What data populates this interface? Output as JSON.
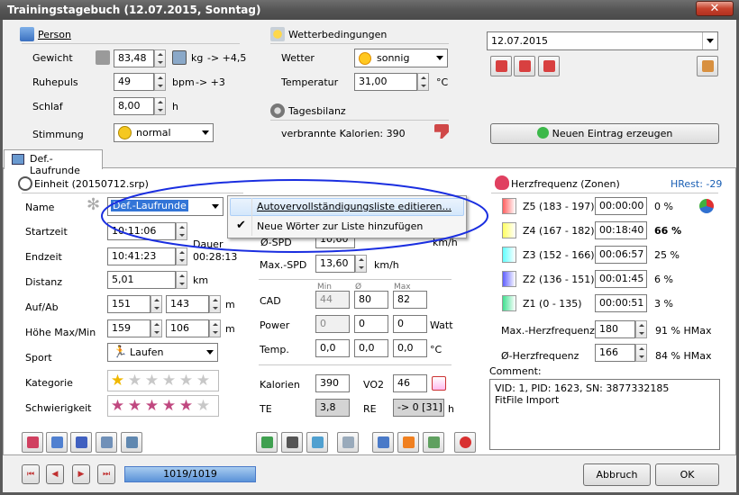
{
  "window": {
    "title": "Trainingstagebuch (12.07.2015, Sonntag)",
    "close": "✕"
  },
  "person": {
    "header": "Person",
    "gewicht": {
      "label": "Gewicht",
      "value": "83,48",
      "unit": "kg",
      "delta": "-> +4,5"
    },
    "ruhepuls": {
      "label": "Ruhepuls",
      "value": "49",
      "unit": "bpm",
      "delta": "-> +3"
    },
    "schlaf": {
      "label": "Schlaf",
      "value": "8,00",
      "unit": "h"
    },
    "stimmung": {
      "label": "Stimmung",
      "value": "normal"
    }
  },
  "weather": {
    "header": "Wetterbedingungen",
    "wetter_label": "Wetter",
    "wetter_value": "sonnig",
    "temp_label": "Temperatur",
    "temp_value": "31,00",
    "temp_unit": "°C"
  },
  "balance": {
    "header": "Tagesbilanz",
    "text": "verbrannte Kalorien: 390"
  },
  "date": {
    "value": "12.07.2015"
  },
  "new_entry_label": "Neuen Eintrag erzeugen",
  "tab": {
    "label": "Def.-Laufrunde"
  },
  "unit": {
    "header": "Einheit (20150712.srp)",
    "name_label": "Name",
    "name_value": "Def.-Laufrunde",
    "start_label": "Startzeit",
    "start_value": "10:11:06",
    "end_label": "Endzeit",
    "end_value": "10:41:23",
    "dauer_label": "Dauer",
    "dauer_value": "00:28:13",
    "dist_label": "Distanz",
    "dist_value": "5,01",
    "dist_unit": "km",
    "aufab_label": "Auf/Ab",
    "auf_value": "151",
    "ab_value": "143",
    "aufab_unit": "m",
    "hoehe_label": "Höhe Max/Min",
    "hmax_value": "159",
    "hmin_value": "106",
    "hoehe_unit": "m",
    "sport_label": "Sport",
    "sport_value": "Laufen",
    "kategorie_label": "Kategorie",
    "kategorie_rating": 1,
    "schwierig_label": "Schwierigkeit",
    "schwierig_rating": 5,
    "stars_max": 6
  },
  "speed": {
    "avg_label": "Ø-SPD",
    "avg_value": "10,60",
    "avg_unit": "km/h",
    "max_label": "Max.-SPD",
    "max_value": "13,60",
    "max_unit": "km/h"
  },
  "sensors": {
    "col_min": "Min",
    "col_avg": "Ø",
    "col_max": "Max",
    "cad_label": "CAD",
    "cad": [
      "44",
      "80",
      "82"
    ],
    "power_label": "Power",
    "power": [
      "0",
      "0",
      "0"
    ],
    "power_unit": "Watt",
    "temp_label": "Temp.",
    "temp": [
      "0,0",
      "0,0",
      "0,0"
    ],
    "temp_unit": "°C",
    "kal_label": "Kalorien",
    "kal_value": "390",
    "vo2_label": "VO2",
    "vo2_value": "46",
    "te_label": "TE",
    "te_value": "3,8",
    "re_label": "RE",
    "re_value": "-> 0 [31]",
    "re_unit": "h"
  },
  "hr": {
    "header": "Herzfrequenz (Zonen)",
    "hrest": "HRest: -29",
    "zones": [
      {
        "label": "Z5 (183 - 197)",
        "time": "00:00:00",
        "pct": "0 %",
        "color": "#ff6060"
      },
      {
        "label": "Z4 (167 - 182)",
        "time": "00:18:40",
        "pct": "66 %",
        "color": "#ffff60"
      },
      {
        "label": "Z3 (152 - 166)",
        "time": "00:06:57",
        "pct": "25 %",
        "color": "#60ffff"
      },
      {
        "label": "Z2 (136 - 151)",
        "time": "00:01:45",
        "pct": "6 %",
        "color": "#6060ff"
      },
      {
        "label": "Z1 (0 - 135)",
        "time": "00:00:51",
        "pct": "3 %",
        "color": "#40e090"
      }
    ],
    "max_label": "Max.-Herzfrequenz",
    "max_value": "180",
    "max_pct": "91 % HMax",
    "avg_label": "Ø-Herzfrequenz",
    "avg_value": "166",
    "avg_pct": "84 % HMax"
  },
  "comment": {
    "label": "Comment:",
    "line1": "VID: 1, PID: 1623, SN: 3877332185",
    "line2": "FitFile Import"
  },
  "nav": {
    "counter": "1019/1019",
    "cancel": "Abbruch",
    "ok": "OK"
  },
  "context_menu": {
    "item1": "Autovervollständigungsliste editieren...",
    "item2": "Neue Wörter zur Liste hinzufügen"
  }
}
